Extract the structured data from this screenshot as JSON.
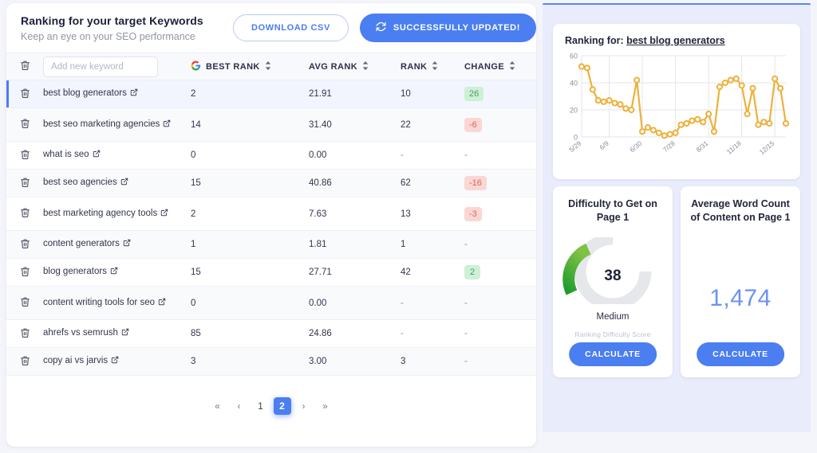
{
  "left": {
    "title": "Ranking for your target Keywords",
    "subtitle": "Keep an eye on your SEO performance",
    "download_label": "DOWNLOAD CSV",
    "updated_label": "SUCCESSFULLY UPDATED!",
    "new_keyword_placeholder": "Add new keyword",
    "new_keyword_value": "",
    "columns": {
      "best": "BEST RANK",
      "avg": "AVG RANK",
      "rank": "RANK",
      "change": "CHANGE"
    },
    "rows": [
      {
        "keyword": "best blog generators",
        "best": "2",
        "avg": "21.91",
        "rank": "10",
        "change": "26",
        "change_dir": "up",
        "selected": true
      },
      {
        "keyword": "best seo marketing agencies",
        "best": "14",
        "avg": "31.40",
        "rank": "22",
        "change": "-6",
        "change_dir": "down",
        "selected": false
      },
      {
        "keyword": "what is seo",
        "best": "0",
        "avg": "0.00",
        "rank": "-",
        "change": "-",
        "change_dir": "none",
        "selected": false
      },
      {
        "keyword": "best seo agencies",
        "best": "15",
        "avg": "40.86",
        "rank": "62",
        "change": "-16",
        "change_dir": "down",
        "selected": false
      },
      {
        "keyword": "best marketing agency tools",
        "best": "2",
        "avg": "7.63",
        "rank": "13",
        "change": "-3",
        "change_dir": "down",
        "selected": false
      },
      {
        "keyword": "content generators",
        "best": "1",
        "avg": "1.81",
        "rank": "1",
        "change": "-",
        "change_dir": "none",
        "selected": false
      },
      {
        "keyword": "blog generators",
        "best": "15",
        "avg": "27.71",
        "rank": "42",
        "change": "2",
        "change_dir": "up",
        "selected": false
      },
      {
        "keyword": "content writing tools for seo",
        "best": "0",
        "avg": "0.00",
        "rank": "-",
        "change": "-",
        "change_dir": "none",
        "selected": false
      },
      {
        "keyword": "ahrefs vs semrush",
        "best": "85",
        "avg": "24.86",
        "rank": "-",
        "change": "-",
        "change_dir": "none",
        "selected": false
      },
      {
        "keyword": "copy ai vs jarvis",
        "best": "3",
        "avg": "3.00",
        "rank": "3",
        "change": "-",
        "change_dir": "none",
        "selected": false
      }
    ],
    "pagination": {
      "first": "«",
      "prev": "‹",
      "pages": [
        "1",
        "2"
      ],
      "active": "2",
      "next": "›",
      "last": "»"
    }
  },
  "right": {
    "chart_card": {
      "title_prefix": "Ranking for: ",
      "title_keyword": "best blog generators"
    },
    "difficulty_card": {
      "title": "Difficulty to Get on Page 1",
      "value": "38",
      "label": "Medium",
      "caption": "Ranking Difficulty Score",
      "button": "CALCULATE",
      "arc_color": "#4caf3f",
      "track_color": "#e6e7ea"
    },
    "wordcount_card": {
      "title": "Average Word Count of Content on Page 1",
      "value": "1,474",
      "button": "CALCULATE",
      "value_color": "#6b93f2"
    }
  },
  "colors": {
    "accent": "#4b7ef0",
    "chart_line": "#edb13c",
    "badge_up_bg": "#cdf0d6",
    "badge_up_fg": "#4f9a63",
    "badge_down_bg": "#fbd7d4",
    "badge_down_fg": "#d9635c",
    "panel_bg": "#e9ecfa"
  },
  "chart_data": {
    "type": "line",
    "title": "Ranking for: best blog generators",
    "xlabel": "",
    "ylabel": "",
    "ylim": [
      0,
      60
    ],
    "yticks": [
      0,
      20,
      40,
      60
    ],
    "grid": true,
    "legend": false,
    "marker": "circle-open",
    "line_color": "#edb13c",
    "xticks": [
      "5/29",
      "6/9",
      "6/30",
      "7/28",
      "8/31",
      "11/18",
      "12/15"
    ],
    "xtick_indices": [
      0,
      5,
      11,
      17,
      23,
      29,
      35
    ],
    "values": [
      52,
      51,
      35,
      27,
      26,
      27,
      25,
      24,
      21,
      20,
      42,
      4,
      7,
      5,
      3,
      1,
      2,
      3,
      9,
      10,
      12,
      13,
      11,
      17,
      4,
      37,
      40,
      42,
      43,
      38,
      17,
      36,
      9,
      11,
      10,
      43,
      36,
      10
    ]
  }
}
